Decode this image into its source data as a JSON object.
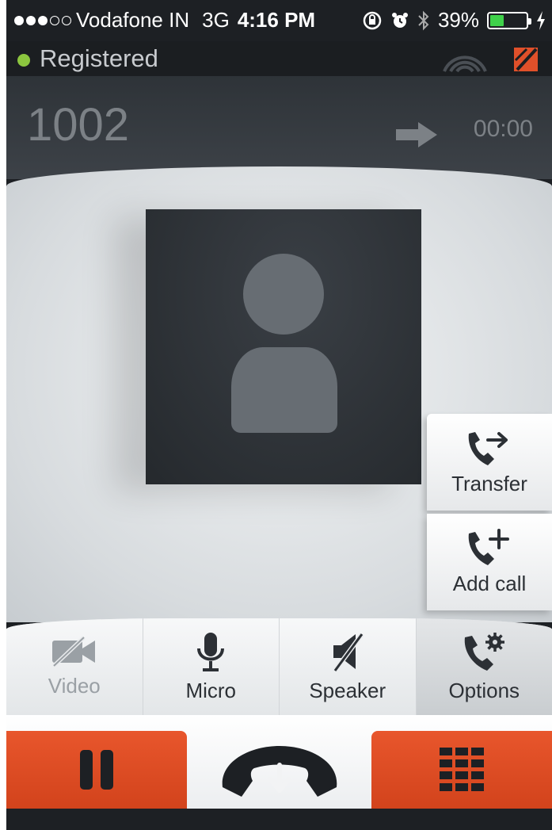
{
  "status_bar": {
    "carrier": "Vodafone IN",
    "network": "3G",
    "time": "4:16 PM",
    "battery_percent": "39%",
    "battery_level": 0.39,
    "signal_bars": 3,
    "signal_max": 5,
    "icons": [
      "rotation-lock-icon",
      "alarm-icon",
      "bluetooth-icon",
      "charging-icon"
    ]
  },
  "registration": {
    "status": "Registered",
    "status_color": "#8cc63f",
    "icons": [
      "wifi-icon",
      "microphone-muted-icon"
    ]
  },
  "call": {
    "number": "1002",
    "direction_icon": "outgoing-arrow-icon",
    "duration": "00:00"
  },
  "side_actions": [
    {
      "label": "Transfer",
      "icon": "phone-transfer-icon"
    },
    {
      "label": "Add call",
      "icon": "phone-add-icon"
    }
  ],
  "toolbar": [
    {
      "label": "Video",
      "icon": "video-off-icon",
      "enabled": false
    },
    {
      "label": "Micro",
      "icon": "microphone-icon",
      "enabled": true
    },
    {
      "label": "Speaker",
      "icon": "speaker-off-icon",
      "enabled": true
    },
    {
      "label": "Options",
      "icon": "phone-settings-icon",
      "enabled": true
    }
  ],
  "bottom_actions": {
    "pause_icon": "pause-icon",
    "hangup_icon": "hang-up-icon",
    "keypad_icon": "keypad-icon",
    "accent_color": "#e0502a"
  }
}
